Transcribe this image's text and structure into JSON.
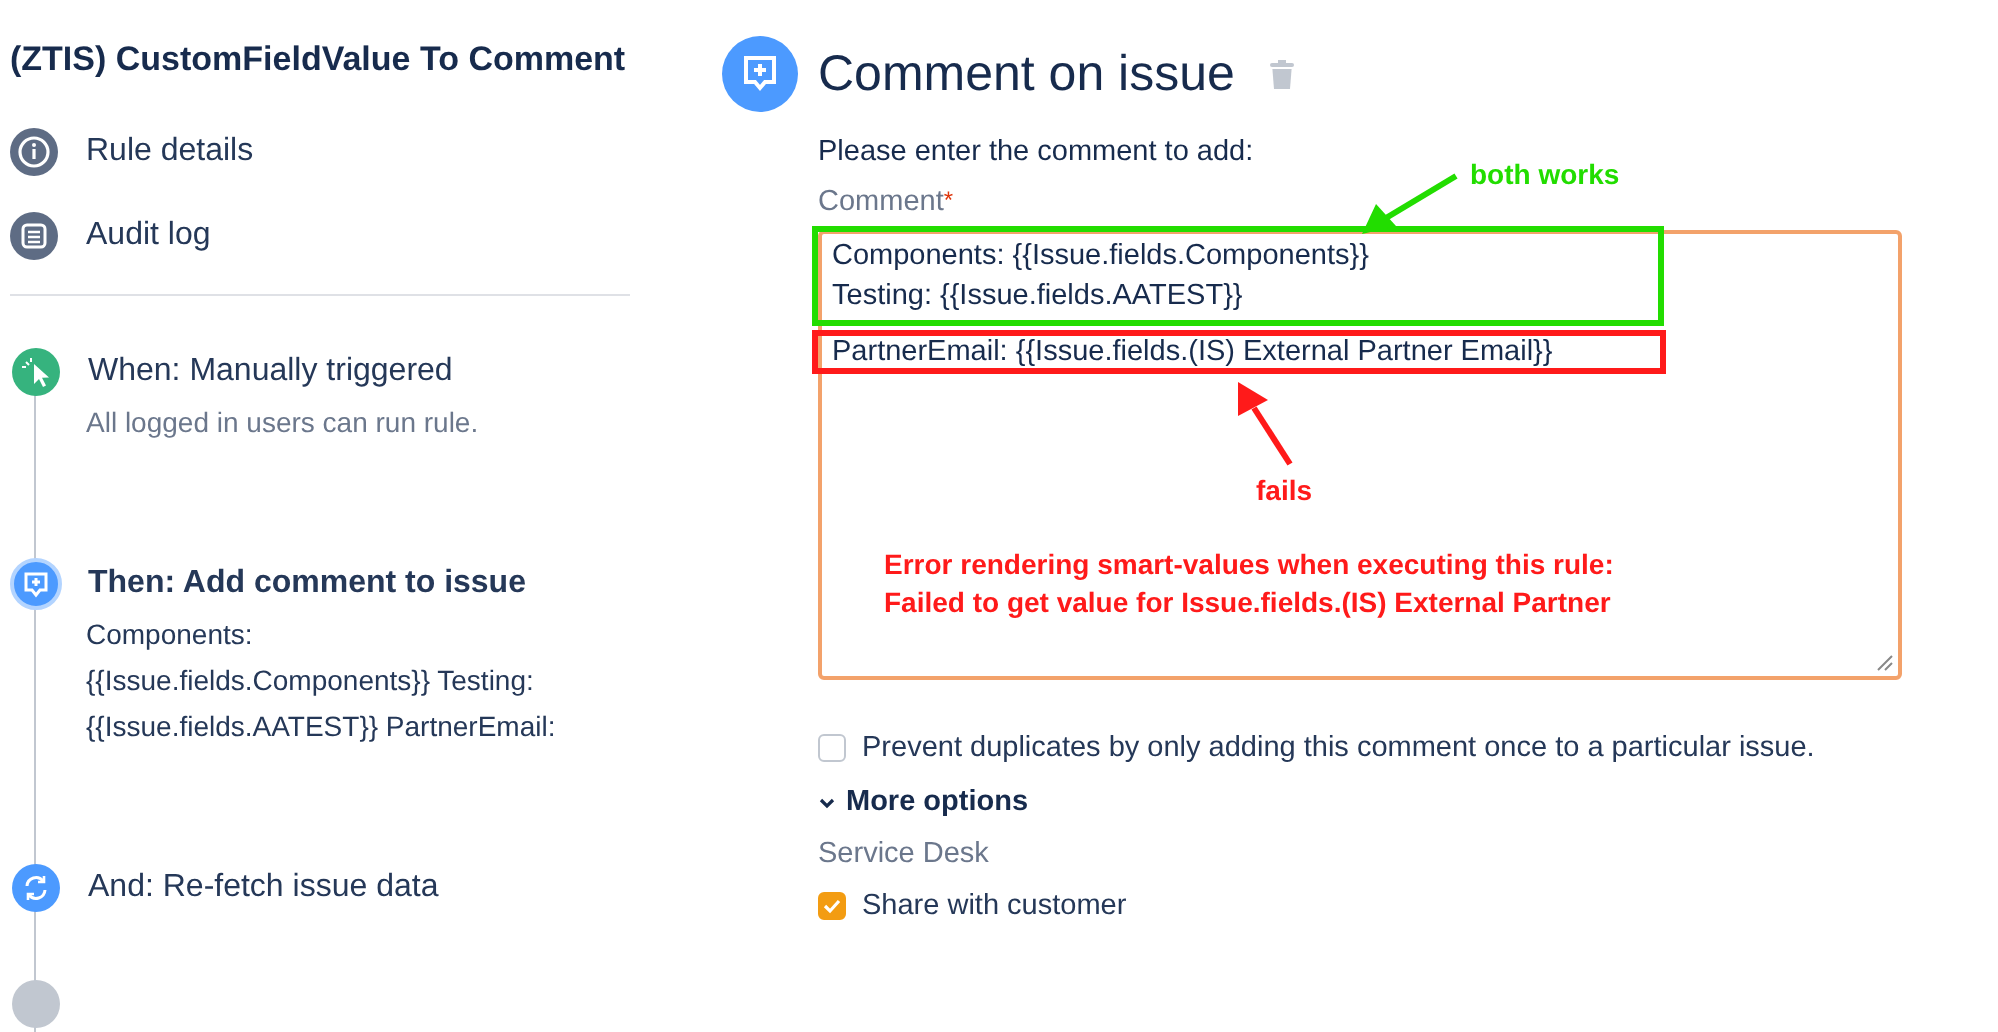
{
  "rule_title": "(ZTIS) CustomFieldValue To Comment",
  "nav": [
    {
      "label": "Rule details",
      "kind": "info"
    },
    {
      "label": "Audit log",
      "kind": "log"
    }
  ],
  "steps": [
    {
      "kind": "trigger",
      "title": "When: Manually triggered",
      "lines": [
        "All logged in users can run rule."
      ],
      "selected": false
    },
    {
      "kind": "comment",
      "title": "Then: Add comment to issue",
      "lines": [
        "Components:",
        "{{Issue.fields.Components}} Testing:",
        "{{Issue.fields.AATEST}} PartnerEmail:"
      ],
      "selected": true
    },
    {
      "kind": "refetch",
      "title": "And: Re-fetch issue data",
      "selected": false
    },
    {
      "kind": "more",
      "selected": false
    }
  ],
  "panel": {
    "title": "Comment on issue",
    "prompt": "Please enter the comment to add:",
    "field_label": "Comment",
    "required_mark": "*",
    "comment_groups": [
      {
        "kind": "works",
        "lines": [
          "Components: {{Issue.fields.Components}}",
          "Testing: {{Issue.fields.AATEST}}"
        ]
      },
      {
        "kind": "fails",
        "lines": [
          "PartnerEmail: {{Issue.fields.(IS) External Partner Email}}"
        ]
      }
    ],
    "prevent_duplicates": {
      "label": "Prevent duplicates by only adding this comment once to a particular issue.",
      "checked": false
    },
    "more_options": {
      "label": "More options",
      "expanded": true
    },
    "section_label": "Service Desk",
    "share": {
      "label": "Share with customer",
      "checked": true
    }
  },
  "annotations": {
    "works_label": "both works",
    "fails_label": "fails",
    "error_lines": [
      "Error rendering smart-values when executing this rule:",
      "Failed to get value for Issue.fields.(IS) External Partner"
    ]
  }
}
